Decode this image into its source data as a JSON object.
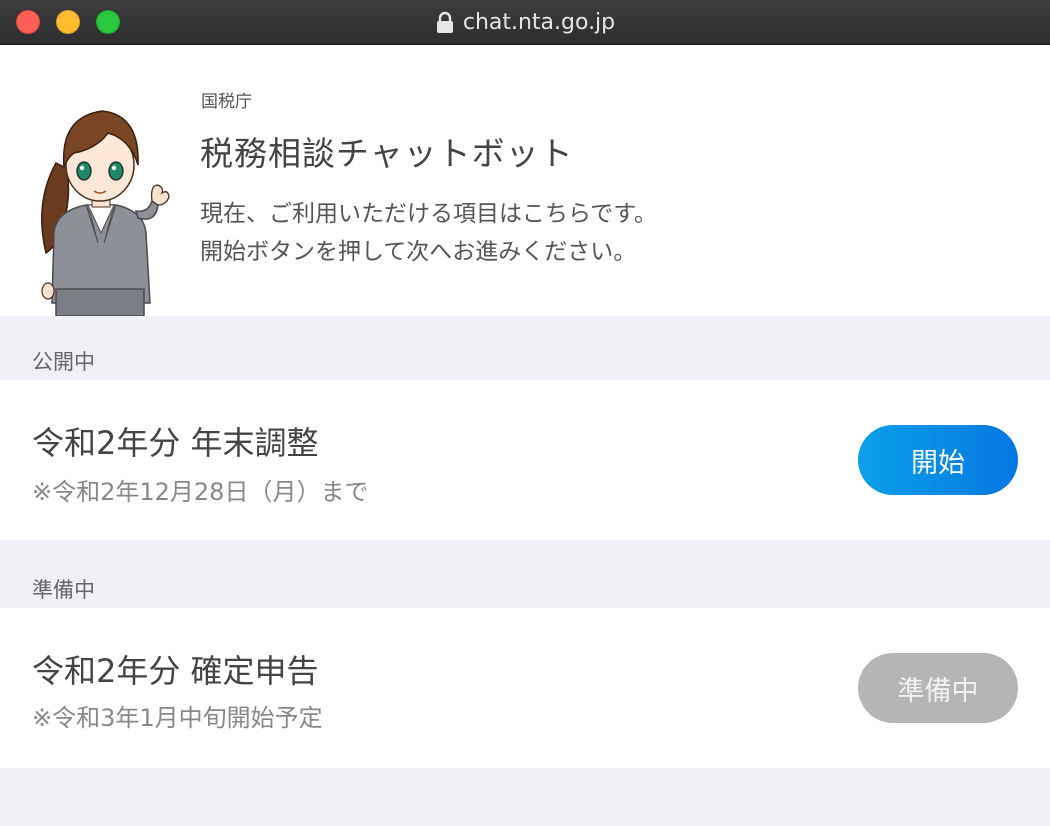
{
  "window": {
    "url": "chat.nta.go.jp"
  },
  "header": {
    "agency": "国税庁",
    "title": "税務相談チャットボット",
    "description_line1": "現在、ご利用いただける項目はこちらです。",
    "description_line2": "開始ボタンを押して次へお進みください。"
  },
  "sections": [
    {
      "label": "公開中",
      "item": {
        "title": "令和2年分 年末調整",
        "note": "※令和2年12月28日（月）まで",
        "button": "開始",
        "button_color": "#0a8de6"
      }
    },
    {
      "label": "準備中",
      "item": {
        "title": "令和2年分 確定申告",
        "note": "※令和3年1月中旬開始予定",
        "button": "準備中",
        "button_color": "#b5b5b5"
      }
    }
  ],
  "colors": {
    "background": "#f0f1f6",
    "card": "#ffffff"
  }
}
